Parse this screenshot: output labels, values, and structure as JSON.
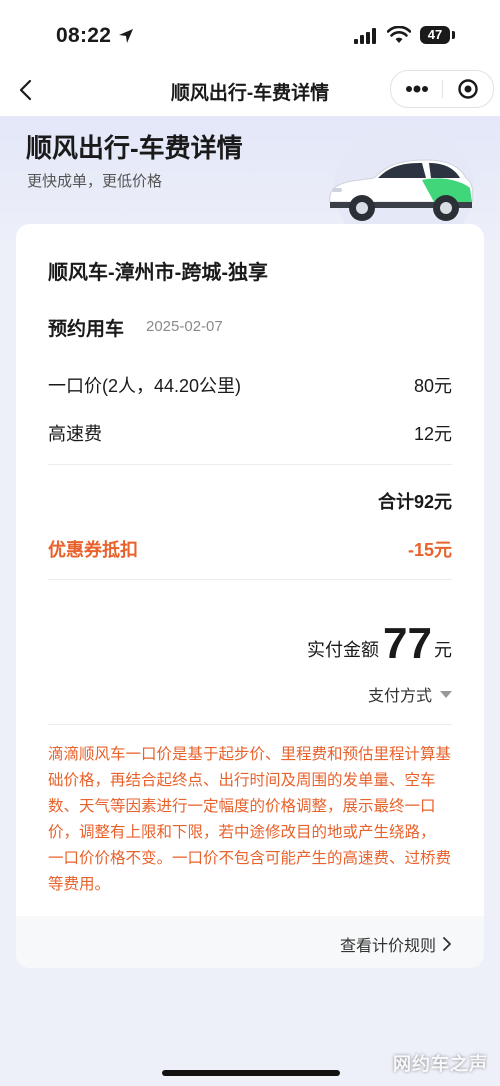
{
  "status_bar": {
    "time": "08:22",
    "battery": "47"
  },
  "nav": {
    "title": "顺风出行-车费详情"
  },
  "hero": {
    "title": "顺风出行-车费详情",
    "subtitle": "更快成单，更低价格"
  },
  "trip": {
    "title": "顺风车-漳州市-跨城-独享",
    "booking_type": "预约用车",
    "date": "2025-02-07"
  },
  "fees": [
    {
      "label": "一口价(2人，44.20公里)",
      "value": "80元"
    },
    {
      "label": "高速费",
      "value": "12元"
    }
  ],
  "total": "合计92元",
  "coupon": {
    "label": "优惠券抵扣",
    "value": "-15元"
  },
  "payment": {
    "paid_label": "实付金额",
    "paid_amount": "77",
    "paid_unit": "元",
    "method_label": "支付方式"
  },
  "notice": "滴滴顺风车一口价是基于起步价、里程费和预估里程计算基础价格，再结合起终点、出行时间及周围的发单量、空车数、天气等因素进行一定幅度的价格调整，展示最终一口价，调整有上限和下限，若中途修改目的地或产生绕路， 一口价价格不变。一口价不包含可能产生的高速费、过桥费等费用。",
  "rules_link": "查看计价规则",
  "watermark": "网约车之声",
  "colors": {
    "accent_orange": "#e8622c",
    "page_bg": "#eef0f9",
    "car_green": "#3fd77a"
  },
  "icons": [
    "location-arrow-icon",
    "signal-icon",
    "wifi-icon",
    "battery-icon",
    "back-icon",
    "more-icon",
    "target-icon",
    "car-illustration",
    "caret-down-icon",
    "chevron-right-icon"
  ]
}
